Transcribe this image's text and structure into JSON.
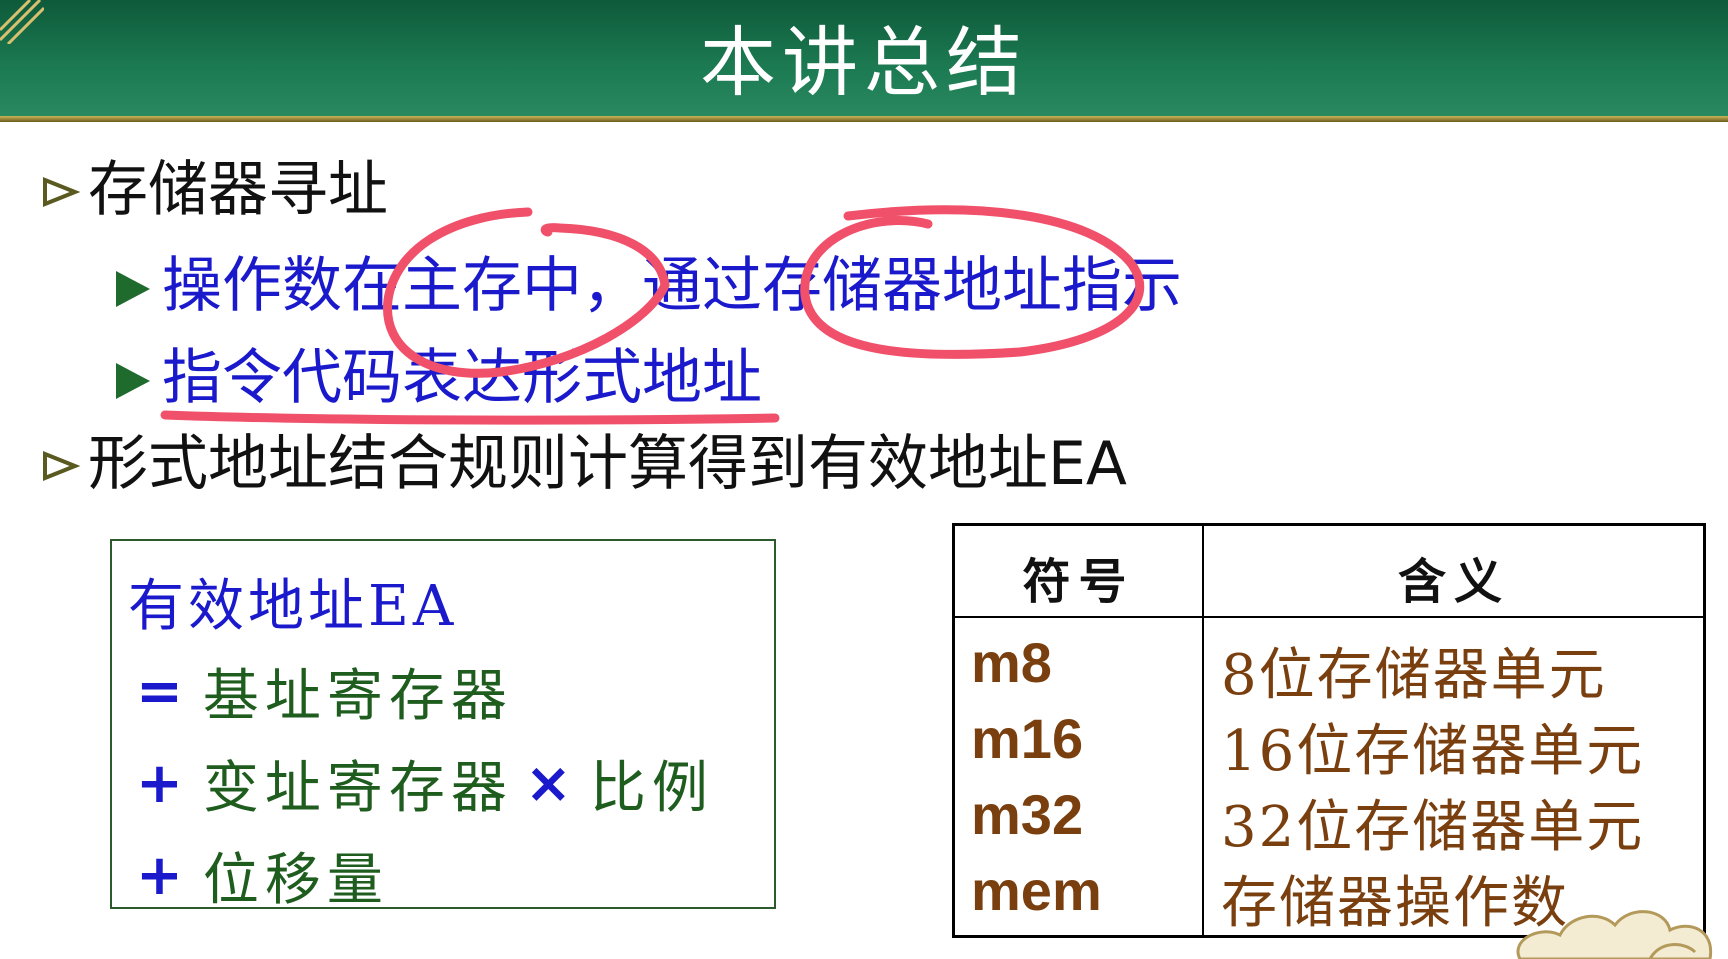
{
  "title": "本讲总结",
  "bullets": {
    "b1": "存储器寻址",
    "b1_sub1": "操作数在主存中，通过存储器地址指示",
    "b1_sub2": "指令代码表达形式地址",
    "b2": "形式地址结合规则计算得到有效地址EA"
  },
  "ea_box": {
    "heading": "有效地址EA",
    "line1_op": "=",
    "line1_text": "基址寄存器",
    "line2_op": "+",
    "line2_text": "变址寄存器",
    "line2_times": "×",
    "line2_tail": "比例",
    "line3_op": "+",
    "line3_text": "位移量"
  },
  "table": {
    "col1": "符号",
    "col2": "含义",
    "rows": [
      {
        "symbol": "m8",
        "meaning": "8位存储器单元"
      },
      {
        "symbol": "m16",
        "meaning": "16位存储器单元"
      },
      {
        "symbol": "m32",
        "meaning": "32位存储器单元"
      },
      {
        "symbol": "mem",
        "meaning": "存储器操作数"
      }
    ]
  },
  "colors": {
    "title_bg": "#1c7a52",
    "blue_text": "#1a1acc",
    "green_text": "#1f5d1f",
    "brown_text": "#7a3f0f",
    "ink_red": "#f0506a"
  }
}
